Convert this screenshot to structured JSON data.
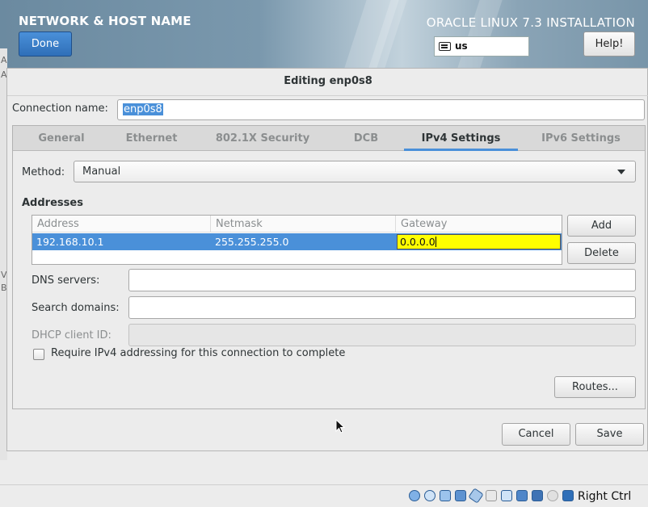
{
  "header": {
    "title": "NETWORK & HOST NAME",
    "done_label": "Done",
    "product": "ORACLE LINUX 7.3 INSTALLATION",
    "keyboard_layout": "us",
    "help_label": "Help!"
  },
  "left_glyphs": [
    "A",
    "A",
    "V",
    "B"
  ],
  "dialog": {
    "title": "Editing enp0s8",
    "connection_name_label": "Connection name:",
    "connection_name_value": "enp0s8",
    "tabs": [
      {
        "label": "General"
      },
      {
        "label": "Ethernet"
      },
      {
        "label": "802.1X Security"
      },
      {
        "label": "DCB"
      },
      {
        "label": "IPv4 Settings",
        "active": true
      },
      {
        "label": "IPv6 Settings"
      }
    ],
    "method_label": "Method:",
    "method_value": "Manual",
    "addresses_label": "Addresses",
    "columns": [
      "Address",
      "Netmask",
      "Gateway"
    ],
    "rows": [
      {
        "address": "192.168.10.1",
        "netmask": "255.255.255.0",
        "gateway": "0.0.0.0"
      }
    ],
    "add_label": "Add",
    "delete_label": "Delete",
    "dns_label": "DNS servers:",
    "dns_value": "",
    "search_label": "Search domains:",
    "search_value": "",
    "dhcp_label": "DHCP client ID:",
    "dhcp_value": "",
    "require_ipv4_label": "Require IPv4 addressing for this connection to complete",
    "require_ipv4_checked": false,
    "routes_label": "Routes...",
    "cancel_label": "Cancel",
    "save_label": "Save"
  },
  "statusbar": {
    "icons": [
      "hard-disk-icon",
      "optical-drive-icon",
      "audio-icon",
      "network-icon",
      "usb-icon",
      "shared-folder-icon",
      "display-icon",
      "video-capture-icon",
      "virtualization-icon",
      "cpu-icon",
      "mouse-integration-icon",
      "keyboard-capture-icon"
    ],
    "host_key": "Right Ctrl"
  },
  "colors": {
    "accent": "#4a90d9",
    "edit_highlight": "#ffff00"
  }
}
